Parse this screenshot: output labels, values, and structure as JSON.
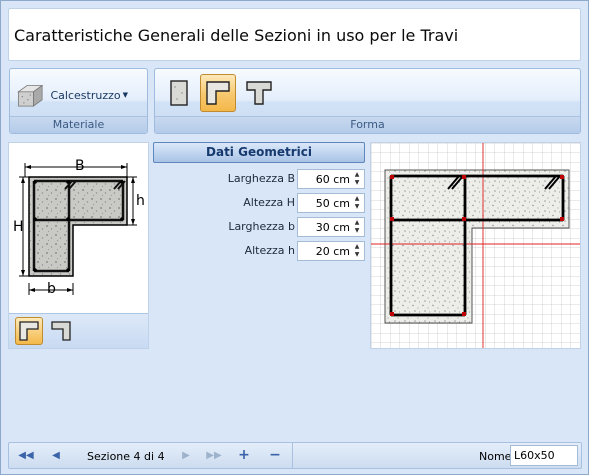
{
  "title": "Caratteristiche Generali delle Sezioni in uso per le Travi",
  "ribbon": {
    "materiale": {
      "button_label": "Calcestruzzo",
      "group_label": "Materiale"
    },
    "forma": {
      "group_label": "Forma",
      "shapes": [
        "rectangular-section",
        "l-section",
        "t-section"
      ],
      "active_shape": "l-section"
    }
  },
  "schematic": {
    "label_B": "B",
    "label_H": "H",
    "label_h": "h",
    "label_b": "b"
  },
  "dati_geometrici": {
    "header": "Dati Geometrici",
    "params": [
      {
        "label": "Larghezza B",
        "value": "60 cm"
      },
      {
        "label": "Altezza H",
        "value": "50 cm"
      },
      {
        "label": "Larghezza b",
        "value": "30 cm"
      },
      {
        "label": "Altezza h",
        "value": "20 cm"
      }
    ]
  },
  "status": {
    "position": "Sezione 4 di 4",
    "name_label": "Nome",
    "name_value": "L60x50"
  },
  "colors": {
    "accent": "#f4b84a",
    "ribbon": "#c9dbf2",
    "rebar": "#c00000",
    "grid_red": "#e02020"
  }
}
